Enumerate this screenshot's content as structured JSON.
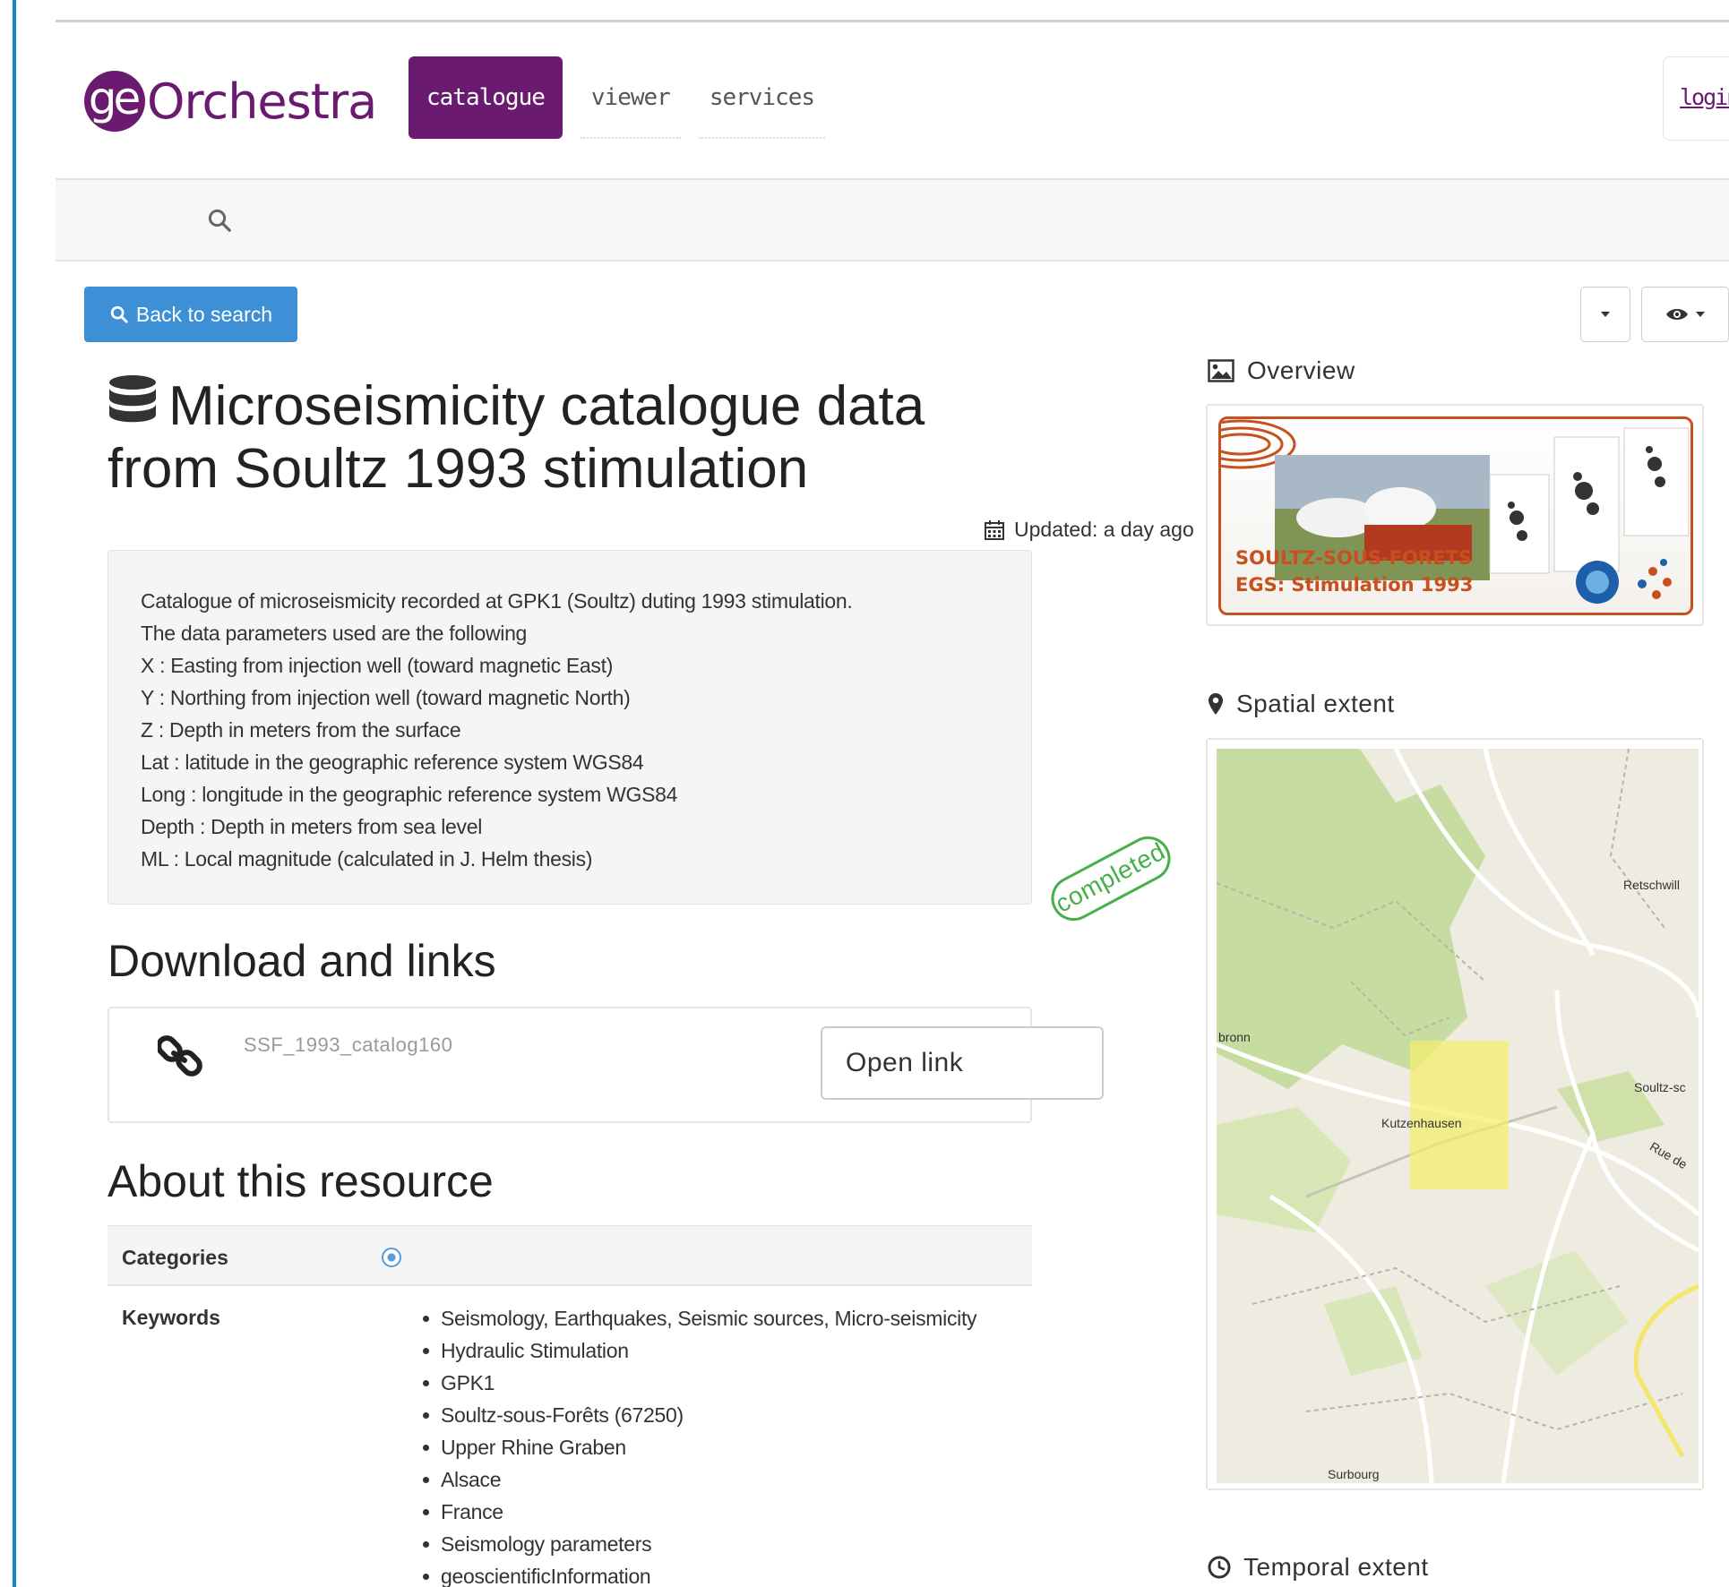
{
  "header": {
    "logo_mark": "ge",
    "logo_text": "Orchestra",
    "nav": [
      {
        "label": "catalogue",
        "active": true
      },
      {
        "label": "viewer",
        "active": false
      },
      {
        "label": "services",
        "active": false
      }
    ],
    "login_label": "login"
  },
  "toolbar": {
    "back_label": "Back to search"
  },
  "record": {
    "title": "Microseismicity catalogue data from Soultz 1993 stimulation",
    "updated": "Updated: a day ago",
    "abstract_lines": [
      "Catalogue of microseismicity recorded at GPK1 (Soultz) duting 1993 stimulation.",
      "The data parameters used are the following",
      "X : Easting from injection well (toward magnetic East)",
      "Y : Northing from injection well (toward magnetic North)",
      "Z : Depth in meters from the surface",
      "Lat : latitude in the geographic reference system WGS84",
      "Long : longitude in the geographic reference system WGS84",
      "Depth : Depth in meters from sea level",
      "ML : Local magnitude (calculated in J. Helm thesis)"
    ],
    "status_stamp": "completed"
  },
  "downloads": {
    "heading": "Download and links",
    "items": [
      {
        "name": "SSF_1993_catalog160",
        "button_label": "Open link"
      }
    ]
  },
  "about": {
    "heading": "About this resource",
    "categories_label": "Categories",
    "keywords_label": "Keywords",
    "keywords": [
      "Seismology, Earthquakes, Seismic sources, Micro-seismicity",
      "Hydraulic Stimulation",
      "GPK1",
      "Soultz-sous-Forêts (67250)",
      "Upper Rhine Graben",
      "Alsace",
      "France",
      "Seismology parameters",
      "geoscientificInformation"
    ]
  },
  "sidebar": {
    "overview_heading": "Overview",
    "overview_image_text": [
      "SOULTZ-SOUS-FORETS",
      "EGS: Stimulation 1993"
    ],
    "spatial_heading": "Spatial extent",
    "temporal_heading": "Temporal extent",
    "map_labels": [
      "Retschwill",
      "bronn",
      "Soultz-sc",
      "Kutzenhausen",
      "Rue de",
      "Surbourg"
    ]
  },
  "colors": {
    "brand": "#6a1b70",
    "primary_button": "#3d8fd6",
    "status_green": "#45b04a",
    "extent_highlight": "#f5f06a"
  }
}
